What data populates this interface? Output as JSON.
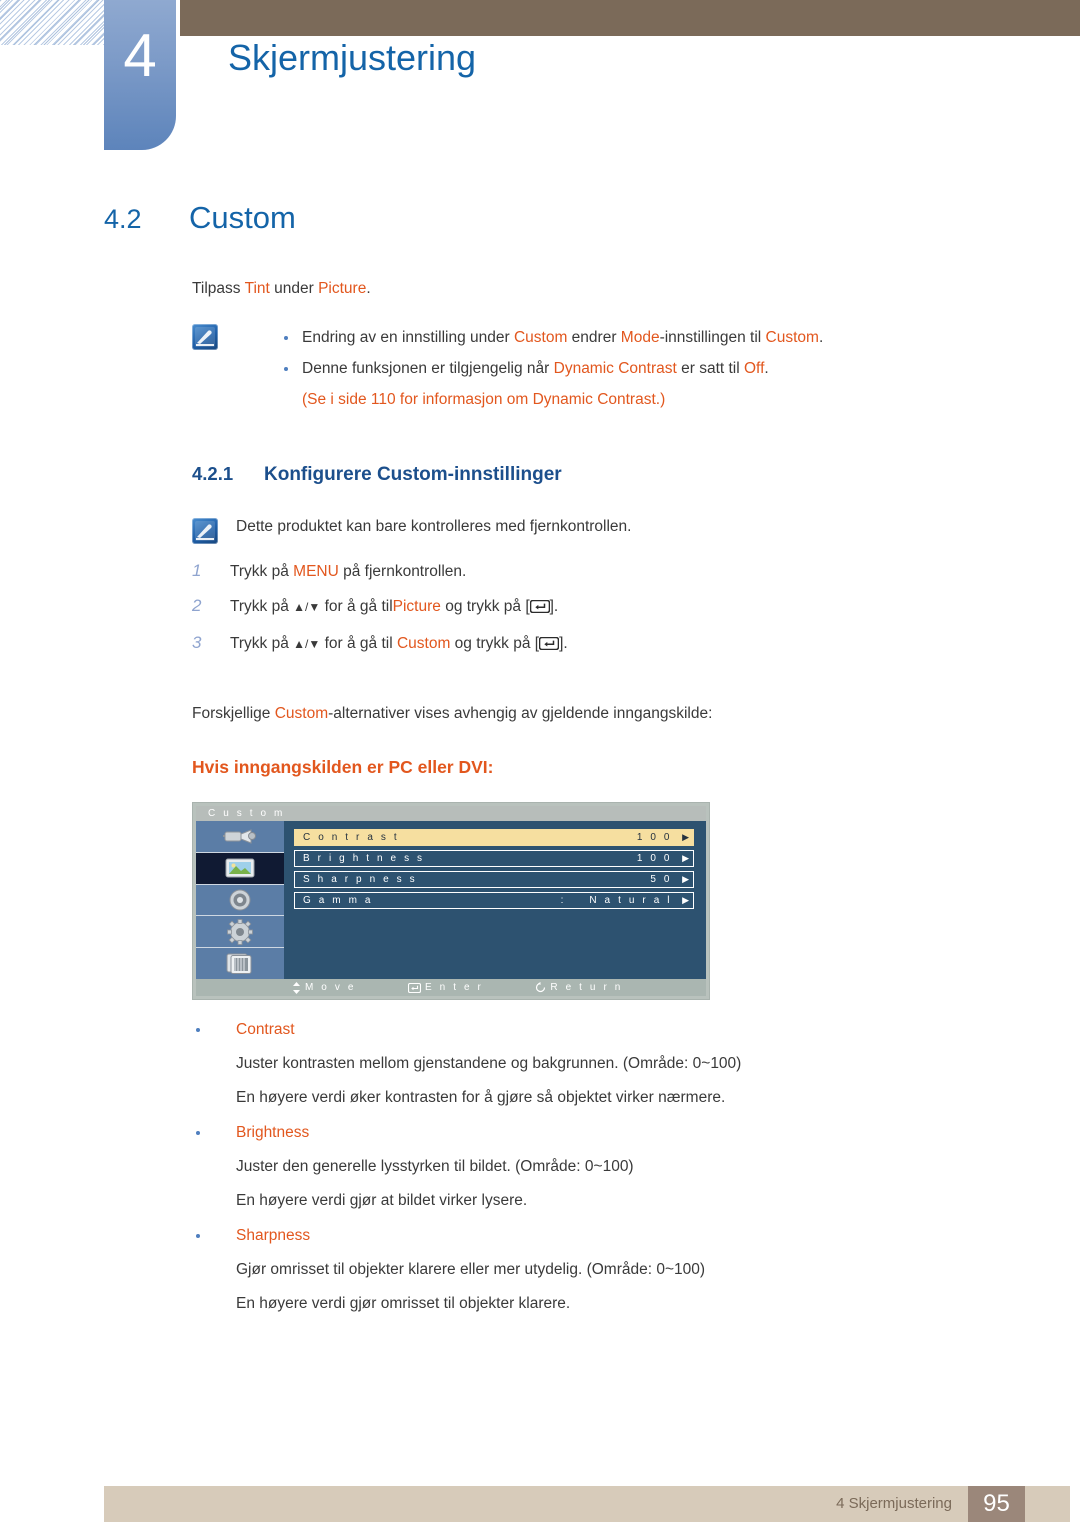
{
  "header": {
    "chapter_number": "4",
    "chapter_title": "Skjermjustering"
  },
  "section": {
    "number": "4.2",
    "title": "Custom",
    "intro_prefix": "Tilpass ",
    "intro_tint": "Tint",
    "intro_mid": " under ",
    "intro_picture": "Picture",
    "intro_suffix": "."
  },
  "notes": [
    {
      "prefix": "Endring av en innstilling under ",
      "k1": "Custom",
      "mid1": " endrer ",
      "k2": "Mode",
      "mid2": "-innstillingen til ",
      "k3": "Custom",
      "suffix": "."
    },
    {
      "prefix": "Denne funksjonen er tilgjengelig når ",
      "k1": "Dynamic Contrast",
      "mid1": " er satt til ",
      "k2": "Off",
      "suffix": "."
    },
    {
      "prefix": "(Se i side 110 for informasjon om ",
      "k1": "Dynamic Contrast",
      "suffix": ".)"
    }
  ],
  "subsection": {
    "number": "4.2.1",
    "title": "Konfigurere Custom-innstillinger",
    "note": "Dette produktet kan bare kontrolleres med fjernkontrollen."
  },
  "steps": [
    {
      "num": "1",
      "pre": "Trykk på ",
      "key": "MENU",
      "key_color": "orange",
      "post": " på fjernkontrollen.",
      "has_arrows": false,
      "has_enter": false
    },
    {
      "num": "2",
      "pre": "Trykk på ",
      "arrows": "▲/▼",
      "mid": " for å gå til",
      "key": "Picture",
      "key_color": "orange",
      "post": " og trykk på [",
      "tail": "].",
      "has_arrows": true,
      "has_enter": true
    },
    {
      "num": "3",
      "pre": "Trykk på ",
      "arrows": "▲/▼",
      "mid": " for å gå til ",
      "key": "Custom",
      "key_color": "orange",
      "post": " og trykk på [",
      "tail": "].",
      "has_arrows": true,
      "has_enter": true
    }
  ],
  "intro2": {
    "prefix": "Forskjellige ",
    "keyword": "Custom",
    "suffix": "-alternativer vises avhengig av gjeldende inngangskilde:"
  },
  "input_heading": "Hvis inngangskilden er PC eller DVI:",
  "osd": {
    "title": "C u s t o m",
    "sidebar_icons": [
      {
        "name": "input-source-icon",
        "selected": false
      },
      {
        "name": "picture-icon",
        "selected": true
      },
      {
        "name": "sound-icon",
        "selected": false
      },
      {
        "name": "setup-gear-icon",
        "selected": false
      },
      {
        "name": "multi-control-icon",
        "selected": false
      }
    ],
    "rows": [
      {
        "label": "C o n t r a s t",
        "colon": "",
        "value": "1 0 0",
        "highlight": true
      },
      {
        "label": "B r i g h t n e s s",
        "colon": "",
        "value": "1 0 0",
        "highlight": false
      },
      {
        "label": "S h a r p n e s s",
        "colon": "",
        "value": "5 0",
        "highlight": false
      },
      {
        "label": "G a m m a",
        "colon": ":",
        "value": "N a t u r a l",
        "highlight": false
      }
    ],
    "caret": "▶",
    "footer": {
      "move": "M o v e",
      "enter": "E n t e r",
      "return": "R e t u r n"
    }
  },
  "definitions": [
    {
      "term": "Contrast",
      "lines": [
        "Juster kontrasten mellom gjenstandene og bakgrunnen. (Område: 0~100)",
        "En høyere verdi øker kontrasten for å gjøre så objektet virker nærmere."
      ]
    },
    {
      "term": "Brightness",
      "lines": [
        "Juster den generelle lysstyrken til bildet. (Område: 0~100)",
        "En høyere verdi gjør at bildet virker lysere."
      ]
    },
    {
      "term": "Sharpness",
      "lines": [
        "Gjør omrisset til objekter klarere eller mer utydelig. (Område: 0~100)",
        "En høyere verdi gjør omrisset til objekter klarere."
      ]
    }
  ],
  "footer": {
    "chapter_label": "4 Skjermjustering",
    "page_number": "95"
  },
  "colors": {
    "accent_blue": "#1464a8",
    "accent_orange": "#e2571e",
    "brown": "#7b6a59",
    "footer_band": "#d7cbba",
    "page_box": "#9b877a"
  }
}
